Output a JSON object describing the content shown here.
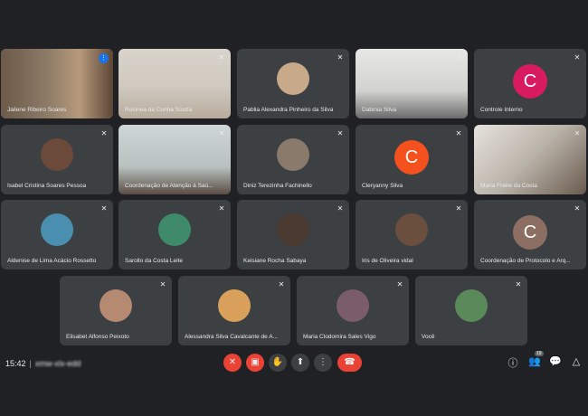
{
  "participants": [
    {
      "name": "Jailene Ribeiro Soares",
      "kind": "video",
      "active": true,
      "speaking": true
    },
    {
      "name": "Rosinea da Cunha Souza",
      "kind": "video"
    },
    {
      "name": "Pablia Alexandra Pinheiro da Silva",
      "kind": "photo"
    },
    {
      "name": "Dabinia Silva",
      "kind": "video"
    },
    {
      "name": "Controle Interno",
      "kind": "letter",
      "letter": "C",
      "color": "#d81b60"
    },
    {
      "name": "Isabel Cristina Soares Pessoa",
      "kind": "photo"
    },
    {
      "name": "Coordenação de Atenção à Saú...",
      "kind": "video"
    },
    {
      "name": "Diniz Terezinha Fachinello",
      "kind": "photo"
    },
    {
      "name": "Cleryanny Silva",
      "kind": "letter",
      "letter": "C",
      "color": "#f4511e"
    },
    {
      "name": "Maria Freire da Costa",
      "kind": "video"
    },
    {
      "name": "Aldenise de Lima Acácio Rossetto",
      "kind": "photo"
    },
    {
      "name": "Sarollo da Costa Leite",
      "kind": "photo"
    },
    {
      "name": "Keisiane Rocha Sabaya",
      "kind": "photo"
    },
    {
      "name": "Iris de Oliveira vidal",
      "kind": "photo"
    },
    {
      "name": "Coordenação de Protocolo e Arq...",
      "kind": "letter",
      "letter": "C",
      "color": "#8d6e63"
    },
    {
      "name": "Elisabet Alfonso Peixoto",
      "kind": "photo"
    },
    {
      "name": "Alessandra Silva Cavalcante de A...",
      "kind": "photo"
    },
    {
      "name": "Maria Clodomira Sales Vigo",
      "kind": "photo"
    },
    {
      "name": "Você",
      "kind": "photo"
    }
  ],
  "bottom_bar": {
    "time": "15:42",
    "separator": "|",
    "meeting_code": "xmw-xlx-edd",
    "people_count": "19"
  },
  "icons": {
    "mic_off": "mic-off-icon",
    "camera_off": "camera-off-icon",
    "hand": "raise-hand-icon",
    "present": "present-icon",
    "more": "more-icon",
    "end": "end-call-icon",
    "info": "info-icon",
    "people": "people-icon",
    "chat": "chat-icon",
    "activities": "activities-icon"
  }
}
